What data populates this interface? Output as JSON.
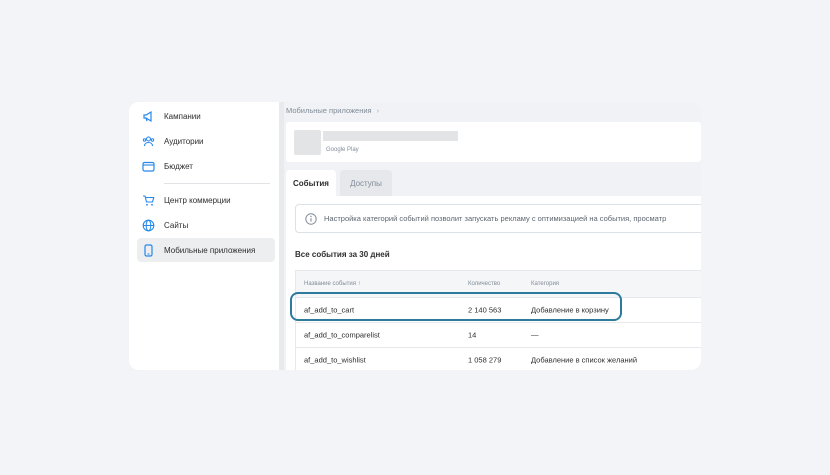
{
  "sidebar": {
    "items": [
      {
        "label": "Кампании",
        "icon": "megaphone-icon"
      },
      {
        "label": "Аудитории",
        "icon": "users-icon"
      },
      {
        "label": "Бюджет",
        "icon": "wallet-icon"
      },
      {
        "label": "Центр коммерции",
        "icon": "cart-icon"
      },
      {
        "label": "Сайты",
        "icon": "globe-icon"
      },
      {
        "label": "Мобильные приложения",
        "icon": "phone-icon",
        "active": true
      }
    ]
  },
  "breadcrumb": {
    "label": "Мобильные приложения",
    "separator": "›"
  },
  "app": {
    "store": "Google Play"
  },
  "tabs": [
    {
      "label": "События",
      "active": true
    },
    {
      "label": "Доступы",
      "active": false
    }
  ],
  "info": {
    "text": "Настройка категорий событий позволит запускать рекламу с оптимизацией на события, просматр"
  },
  "events": {
    "title": "Все события за 30 дней",
    "columns": [
      "Название события ↑",
      "Количество",
      "Категория"
    ],
    "rows": [
      {
        "name": "af_add_to_cart",
        "count": "2 140 563",
        "category": "Добавление в корзину"
      },
      {
        "name": "af_add_to_comparelist",
        "count": "14",
        "category": "—"
      },
      {
        "name": "af_add_to_wishlist",
        "count": "1 058 279",
        "category": "Добавление в список желаний"
      }
    ]
  },
  "colors": {
    "accent": "#2d7a9c",
    "icon": "#2688eb"
  }
}
